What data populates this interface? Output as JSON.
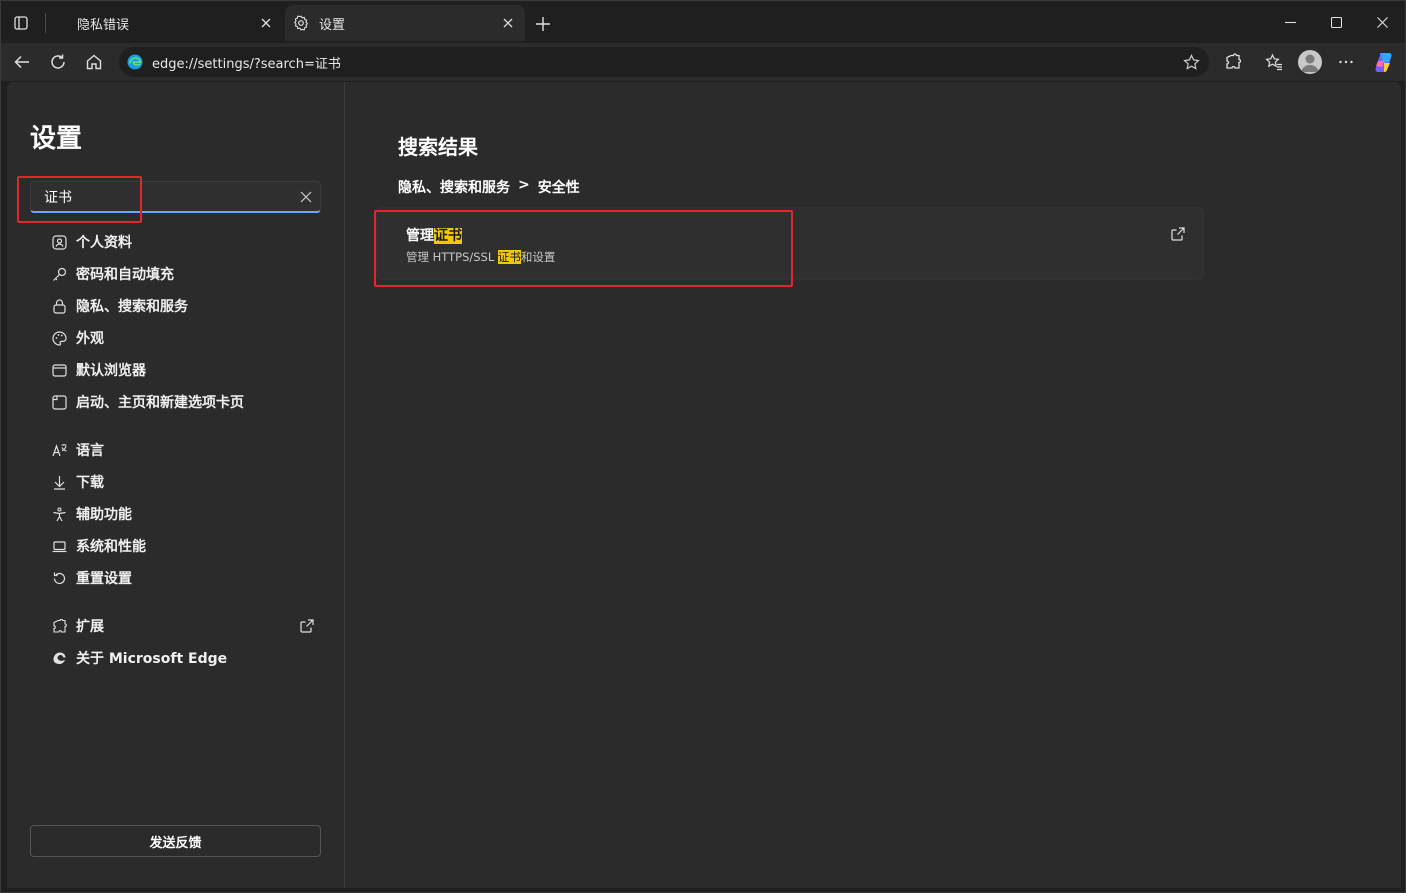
{
  "tabs": [
    {
      "title": "隐私错误",
      "active": false
    },
    {
      "title": "设置",
      "active": true
    }
  ],
  "address": {
    "url": "edge://settings/?search=证书"
  },
  "sidebar": {
    "title": "设置",
    "search_value": "证书",
    "items": [
      {
        "label": "个人资料",
        "icon": "profile-icon"
      },
      {
        "label": "密码和自动填充",
        "icon": "key-icon"
      },
      {
        "label": "隐私、搜索和服务",
        "icon": "lock-icon"
      },
      {
        "label": "外观",
        "icon": "palette-icon"
      },
      {
        "label": "默认浏览器",
        "icon": "browser-icon"
      },
      {
        "label": "启动、主页和新建选项卡页",
        "icon": "startup-icon"
      },
      {
        "label": "语言",
        "icon": "language-icon"
      },
      {
        "label": "下载",
        "icon": "download-icon"
      },
      {
        "label": "辅助功能",
        "icon": "accessibility-icon"
      },
      {
        "label": "系统和性能",
        "icon": "laptop-icon"
      },
      {
        "label": "重置设置",
        "icon": "reset-icon"
      },
      {
        "label": "扩展",
        "icon": "extension-icon"
      },
      {
        "label": "关于 Microsoft Edge",
        "icon": "edge-logo-icon"
      }
    ],
    "feedback_label": "发送反馈"
  },
  "main": {
    "results_title": "搜索结果",
    "breadcrumb": {
      "parent": "隐私、搜索和服务",
      "separator": ">",
      "child": "安全性"
    },
    "result": {
      "title_prefix": "管理",
      "title_highlight": "证书",
      "desc_prefix": "管理 HTTPS/SSL ",
      "desc_highlight": "证书",
      "desc_suffix": "和设置"
    }
  },
  "colors": {
    "accent": "#6ba5ff",
    "highlight": "#f0c808",
    "annotation": "#e0282c"
  }
}
